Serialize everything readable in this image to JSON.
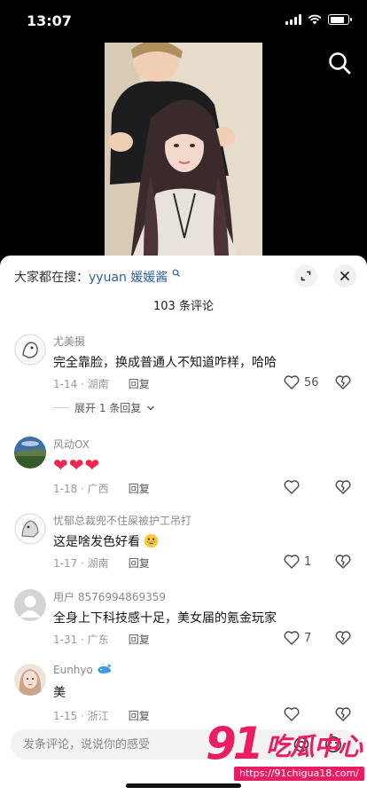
{
  "status_bar": {
    "time": "13:07"
  },
  "header": {
    "search_prefix": "大家都在搜：",
    "search_keyword": "yyuan 媛媛酱",
    "comment_count": "103 条评论"
  },
  "comments": [
    {
      "user": "尤美摄",
      "text": "完全靠脸，换成普通人不知道咋样，哈哈",
      "date_location": "1-14 · 湖南",
      "reply_label": "回复",
      "likes": "56",
      "expand_label": "展开 1 条回复"
    },
    {
      "user": "风动OX",
      "text": "❤❤❤",
      "date_location": "1-18 · 广西",
      "reply_label": "回复",
      "likes": ""
    },
    {
      "user": "忧郁总裁兜不住屎被护工吊打",
      "text": "这是啥发色好看",
      "date_location": "1-17 · 湖南",
      "reply_label": "回复",
      "likes": "1"
    },
    {
      "user": "用户 8576994869359",
      "text": "全身上下科技感十足，美女届的氪金玩家",
      "date_location": "1-31 · 广东",
      "reply_label": "回复",
      "likes": "7"
    },
    {
      "user": "Eunhyo",
      "text": "美",
      "date_location": "1-15 · 浙江",
      "reply_label": "回复",
      "likes": ""
    }
  ],
  "input": {
    "placeholder": "发条评论，说说你的感受"
  },
  "watermark": {
    "brand_number": "91",
    "brand_name": "吃瓜中心",
    "url": "https://91chigua18.com/"
  },
  "colors": {
    "keyword": "#2f5f9e",
    "watermark": "#ec1c63",
    "heart": "#f0264f"
  }
}
